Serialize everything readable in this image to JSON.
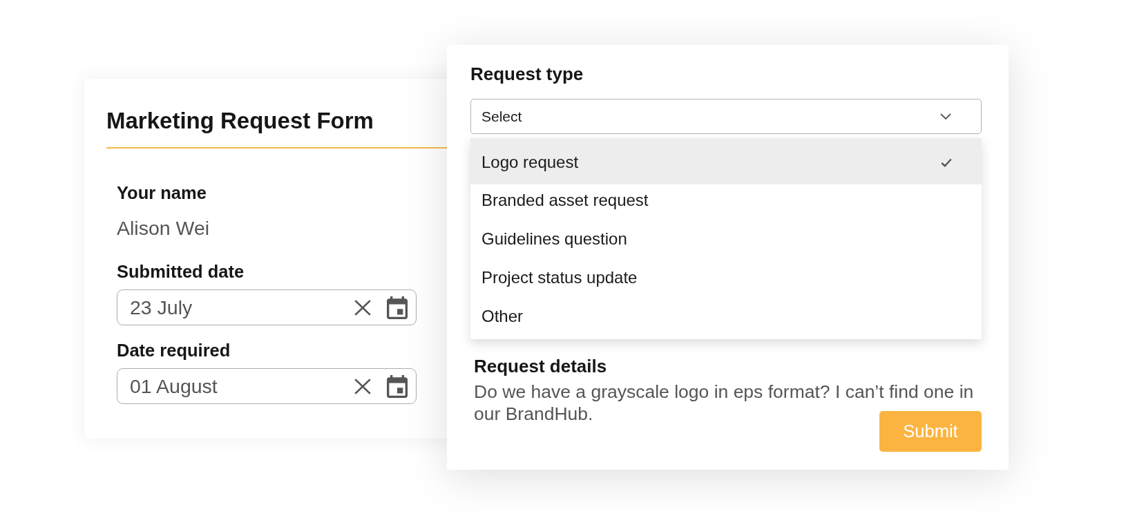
{
  "left_form": {
    "title": "Marketing Request Form",
    "fields": [
      {
        "kind": "text",
        "label": "Your name",
        "value": "Alison Wei"
      },
      {
        "kind": "date",
        "label": "Submitted date",
        "value": "23 July"
      },
      {
        "kind": "date",
        "label": "Date required",
        "value": "01 August"
      }
    ]
  },
  "right_form": {
    "request_type": {
      "label": "Request type",
      "placeholder": "Select",
      "expanded": true,
      "options": [
        {
          "label": "Logo request",
          "selected": true
        },
        {
          "label": "Branded asset request",
          "selected": false
        },
        {
          "label": "Guidelines question",
          "selected": false
        },
        {
          "label": "Project status update",
          "selected": false
        },
        {
          "label": "Other",
          "selected": false
        }
      ]
    },
    "request_details": {
      "label": "Request details",
      "value": "Do we have a grayscale logo in eps format? I can’t find one in our BrandHub."
    },
    "submit_button": {
      "label": "Submit"
    }
  }
}
